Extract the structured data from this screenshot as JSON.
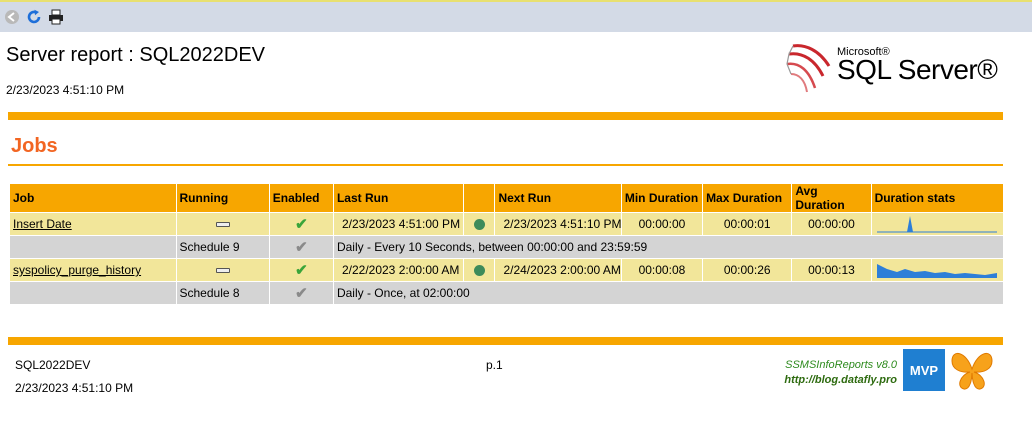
{
  "toolbar": {
    "back_icon": "back-arrow-icon",
    "refresh_icon": "refresh-icon",
    "print_icon": "printer-icon"
  },
  "header": {
    "title": "Server report : SQL2022DEV",
    "date": "2/23/2023 4:51:10 PM",
    "logo_microsoft": "Microsoft®",
    "logo_product": "SQL Server®"
  },
  "section": {
    "title": "Jobs"
  },
  "table": {
    "columns": [
      "Job",
      "Running",
      "Enabled",
      "Last Run",
      "",
      "Next Run",
      "Min Duration",
      "Max Duration",
      "Avg Duration",
      "Duration stats"
    ],
    "rows": [
      {
        "job": "Insert Date",
        "last_run": "2/23/2023 4:51:00 PM",
        "next_run": "2/23/2023 4:51:10 PM",
        "min_duration": "00:00:00",
        "max_duration": "00:00:01",
        "avg_duration": "00:00:00",
        "schedule_name": "Schedule 9",
        "schedule_desc": "Daily - Every 10 Seconds, between 00:00:00 and 23:59:59"
      },
      {
        "job": "syspolicy_purge_history",
        "last_run": "2/22/2023 2:00:00 AM",
        "next_run": "2/24/2023 2:00:00 AM",
        "min_duration": "00:00:08",
        "max_duration": "00:00:26",
        "avg_duration": "00:00:13",
        "schedule_name": "Schedule 8",
        "schedule_desc": "Daily - Once, at 02:00:00"
      }
    ]
  },
  "footer": {
    "server": "SQL2022DEV",
    "date": "2/23/2023 4:51:10 PM",
    "page": "p.1",
    "brand": "SSMSInfoReports v8.0",
    "url": "http://blog.datafly.pro",
    "mvp": "MVP"
  },
  "colors": {
    "accent_orange": "#f7a600",
    "section_title": "#f26522",
    "job_row": "#f2e69a",
    "schedule_row": "#d4d4d4",
    "sparkline": "#2e7fd8"
  }
}
